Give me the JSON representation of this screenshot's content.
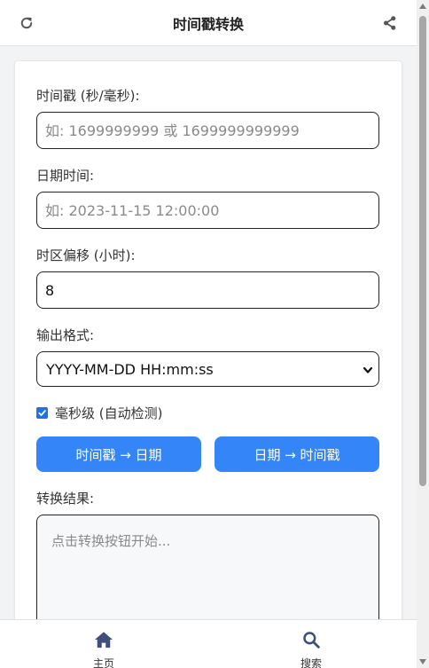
{
  "header": {
    "title": "时间戳转换",
    "refresh_icon": "refresh-icon",
    "share_icon": "share-icon"
  },
  "form": {
    "timestamp": {
      "label": "时间戳 (秒/毫秒):",
      "value": "",
      "placeholder": "如: 1699999999 或 1699999999999"
    },
    "datetime": {
      "label": "日期时间:",
      "value": "",
      "placeholder": "如: 2023-11-15 12:00:00"
    },
    "timezone": {
      "label": "时区偏移 (小时):",
      "value": "8"
    },
    "format": {
      "label": "输出格式:",
      "selected": "YYYY-MM-DD HH:mm:ss"
    },
    "millis": {
      "label": "毫秒级 (自动检测)",
      "checked": true
    }
  },
  "actions": {
    "ts_to_date": "时间戳 → 日期",
    "date_to_ts": "日期 → 时间戳"
  },
  "result": {
    "label": "转换结果:",
    "placeholder": "点击转换按钮开始..."
  },
  "bottom_nav": {
    "home": "主页",
    "search": "搜索"
  },
  "colors": {
    "accent": "#3485f7",
    "checkbox": "#1a73e8"
  }
}
